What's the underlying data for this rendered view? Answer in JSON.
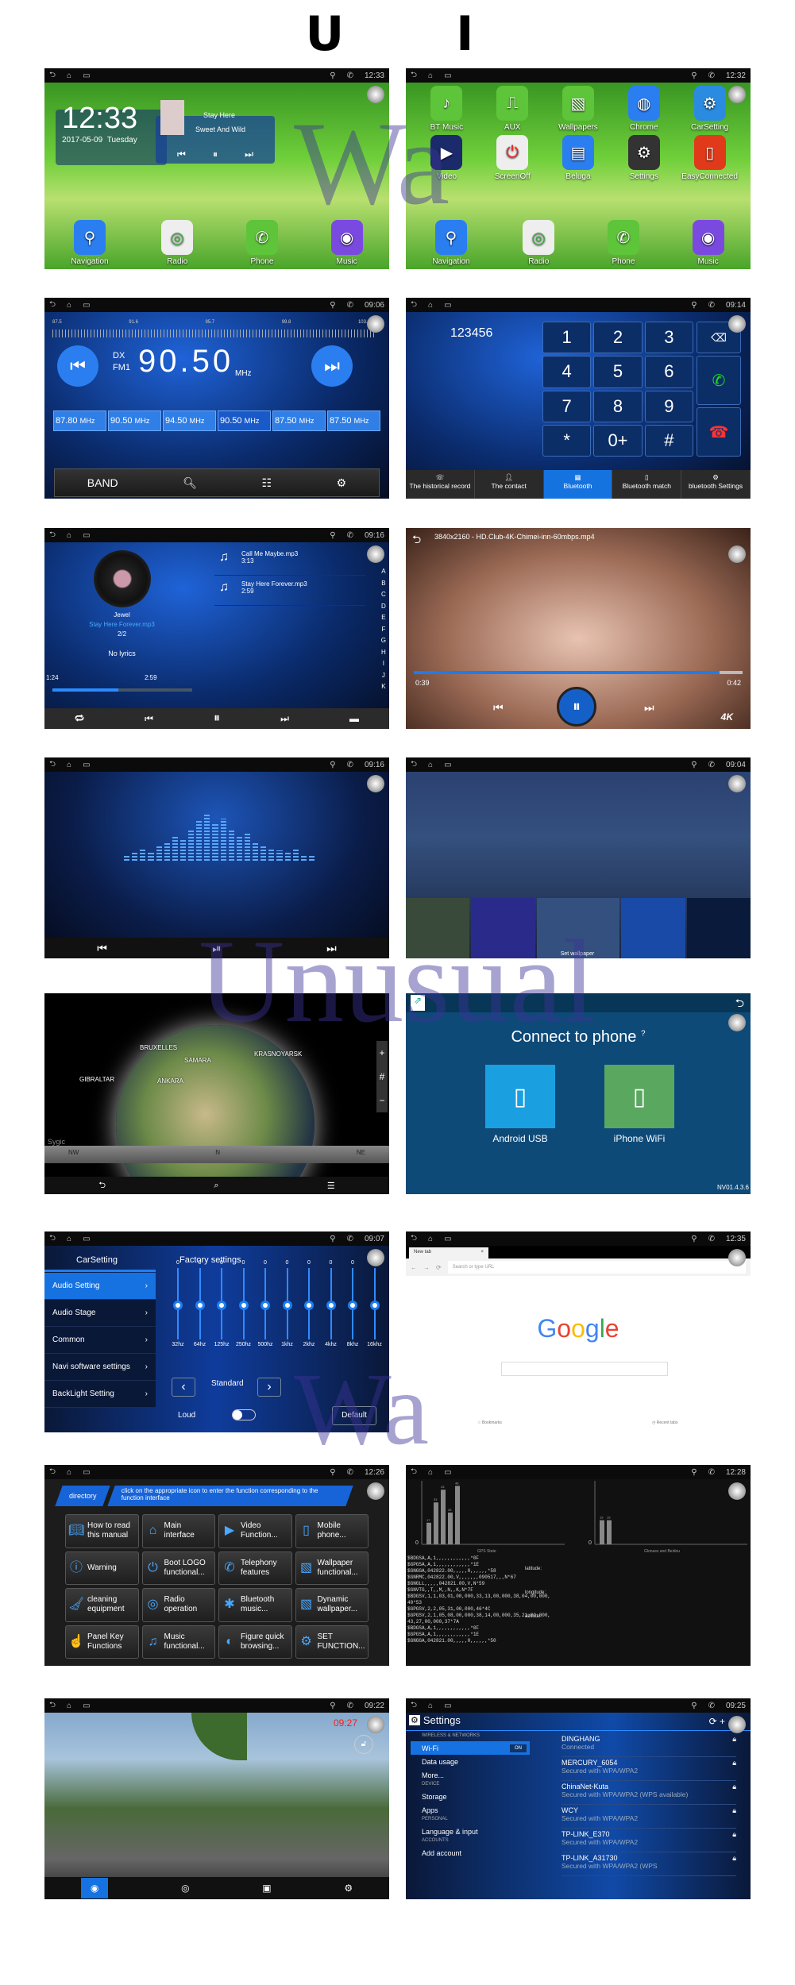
{
  "heading": "U I",
  "watermark": {
    "line1": "Wa",
    "line2": "Unusual"
  },
  "colors": {
    "accent": "#1672e0",
    "panel_dark": "#0a1a3a",
    "home_green": "#5fbf2e"
  },
  "home1": {
    "time": "12:33",
    "clock": "12:33",
    "date": "2017-05-09",
    "day": "Tuesday",
    "song": "Stay Here",
    "album": "Sweet And Wild",
    "dock": [
      "Navigation",
      "Radio",
      "Phone",
      "Music"
    ]
  },
  "home2": {
    "time": "12:32",
    "apps": [
      "BT Music",
      "AUX",
      "Wallpapers",
      "Chrome",
      "CarSetting",
      "Video",
      "ScreenOff",
      "Beluga",
      "Settings",
      "EasyConnected"
    ],
    "dock": [
      "Navigation",
      "Radio",
      "Phone",
      "Music"
    ]
  },
  "radio": {
    "time": "09:06",
    "scale": [
      "87.5",
      "91.6",
      "95.7",
      "99.8",
      "103.9"
    ],
    "mode": "DX",
    "band": "FM1",
    "freq": "90.50",
    "unit": "MHz",
    "presets": [
      "87.80",
      "90.50",
      "94.50",
      "90.50",
      "87.50",
      "87.50"
    ],
    "band_btn": "BAND"
  },
  "dialer": {
    "time": "09:14",
    "number": "123456",
    "keys": [
      "1",
      "2",
      "3",
      "4",
      "5",
      "6",
      "7",
      "8",
      "9",
      "*",
      "0+",
      "#"
    ],
    "tabs": [
      "The historical record",
      "The contact",
      "Bluetooth",
      "Bluetooth match",
      "bluetooth Settings"
    ]
  },
  "music": {
    "time": "09:16",
    "artist": "Jewel",
    "track": "Stay Here Forever.mp3",
    "count": "2/2",
    "lyrics": "No lyrics",
    "elapsed": "1:24",
    "total": "2:59",
    "progress": 0.47,
    "list": [
      {
        "name": "Call Me Maybe.mp3",
        "dur": "3:13"
      },
      {
        "name": "Stay Here Forever.mp3",
        "dur": "2:59"
      }
    ],
    "alpha": [
      "A",
      "B",
      "C",
      "D",
      "E",
      "F",
      "G",
      "H",
      "I",
      "J",
      "K"
    ]
  },
  "video": {
    "file": "3840x2160 - HD.Club-4K-Chimei-inn-60mbps.mp4",
    "elapsed": "0:39",
    "total": "0:42",
    "progress": 0.93,
    "badge": "4K"
  },
  "visualizer": {
    "time": "09:16"
  },
  "wallpaper": {
    "time": "09:04",
    "label": "Set wallpaper"
  },
  "map": {
    "cities": [
      "BRUXELLES",
      "SAMARA",
      "KRASNOYARSK",
      "GIBRALTAR",
      "ANKARA"
    ],
    "compass": [
      "NW",
      "N",
      "NE"
    ],
    "brand": "Sygic"
  },
  "connect": {
    "title": "Connect to phone",
    "options": [
      "Android USB",
      "iPhone WiFi"
    ],
    "version": "NV01.4.3.6"
  },
  "carsetting": {
    "time": "09:07",
    "tabs": [
      "CarSetting",
      "Factory settings"
    ],
    "menu": [
      "Audio Setting",
      "Audio Stage",
      "Common",
      "Navi software settings",
      "BackLight Setting"
    ],
    "bands": [
      "32hz",
      "64hz",
      "125hz",
      "250hz",
      "500hz",
      "1khz",
      "2khz",
      "4khz",
      "8khz",
      "16khz"
    ],
    "values": [
      "0",
      "0",
      "0",
      "0",
      "0",
      "0",
      "0",
      "0",
      "0",
      "0"
    ],
    "preset": "Standard",
    "loud": "Loud",
    "default": "Default"
  },
  "browser": {
    "time": "12:35",
    "tab": "New tab",
    "placeholder": "Search or type URL",
    "logo": "Google",
    "bookmarks": "Bookmarks",
    "recent": "Recent tabs"
  },
  "manual": {
    "time": "12:26",
    "directory": "directory",
    "hint": "click on the appropriate icon to enter the function corresponding to the function interface",
    "items": [
      [
        "How to read",
        "this manual"
      ],
      [
        "Main",
        "interface"
      ],
      [
        "Video",
        "Function..."
      ],
      [
        "Mobile",
        "phone..."
      ],
      [
        "Warning",
        ""
      ],
      [
        "Boot LOGO",
        "functional..."
      ],
      [
        "Telephony",
        "features"
      ],
      [
        "Wallpaper",
        "functional..."
      ],
      [
        "cleaning",
        "equipment"
      ],
      [
        "Radio",
        "operation"
      ],
      [
        "Bluetooth",
        "music..."
      ],
      [
        "Dynamic",
        "wallpaper..."
      ],
      [
        "Panel Key",
        "Functions"
      ],
      [
        "Music",
        "functional..."
      ],
      [
        "Figure quick",
        "browsing..."
      ],
      [
        "SET",
        "FUNCTION..."
      ]
    ]
  },
  "gps": {
    "time": "12:28",
    "left_label": "GPS State",
    "right_label": "Glonass and Beidou",
    "zero": "0",
    "fields": [
      "latitude:",
      "longitude:",
      "altitude:"
    ],
    "gps_bars": [
      17,
      33,
      43,
      25,
      46
    ],
    "glonass_bars": [
      19,
      19
    ],
    "nmea": [
      "$BDGSA,A,1,,,,,,,,,,,,*0F",
      "$GPGSA,A,1,,,,,,,,,,,,*1E",
      "$GNGGA,042822.00,,,,,0,,,,,,*58",
      "$GNRMC,042822.00,V,,,,,,,090517,,,N*67",
      "$GNGLL,,,,,042821.00,V,N*59",
      "$GNVTG,,T,,M,,N,,K,N*7F",
      "$BDGSV,1,1,03,01,00,000,33,13,00,000,38,04,00,000,",
      "40*53",
      "$GPGSV,2,2,05,31,00,000,46*4C",
      "$GPGSV,2,1,05,08,00,000,38,14,00,000,35,21,00,000,",
      "43,27,00,000,37*7A",
      "$BDGSA,A,1,,,,,,,,,,,,*0F",
      "$GPGSA,A,1,,,,,,,,,,,,*1E",
      "$GNGGA,042821.00,,,,,0,,,,,,*50"
    ]
  },
  "dashcam": {
    "time": "09:22",
    "overlay": "09:27"
  },
  "settings": {
    "time": "09:25",
    "title": "Settings",
    "sections": {
      "wireless": "WIRELESS & NETWORKS",
      "device": "DEVICE",
      "personal": "PERSONAL",
      "accounts": "ACCOUNTS"
    },
    "wifi": "Wi-Fi",
    "wifi_state": "ON",
    "items": [
      "Data usage",
      "More...",
      "Storage",
      "Apps",
      "Language & input",
      "Add account"
    ],
    "networks": [
      {
        "ssid": "DINGHANG",
        "status": "Connected"
      },
      {
        "ssid": "MERCURY_6054",
        "status": "Secured with WPA/WPA2"
      },
      {
        "ssid": "ChinaNet-Kuta",
        "status": "Secured with WPA/WPA2 (WPS available)"
      },
      {
        "ssid": "WCY",
        "status": "Secured with WPA/WPA2"
      },
      {
        "ssid": "TP-LINK_E370",
        "status": "Secured with WPA/WPA2"
      },
      {
        "ssid": "TP-LINK_A31730",
        "status": "Secured with WPA/WPA2 (WPS"
      }
    ]
  }
}
